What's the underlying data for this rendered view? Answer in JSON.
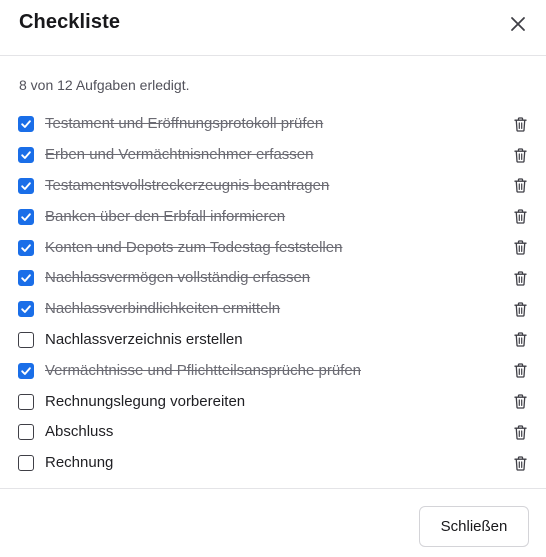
{
  "dialog": {
    "title": "Checkliste",
    "close_icon": "close-icon",
    "progress_text": "8 von 12 Aufgaben erledigt.",
    "close_button_label": "Schließen"
  },
  "colors": {
    "accent": "#1a6ee8",
    "done_text": "#6b6b73",
    "text": "#1f1f23"
  },
  "items": [
    {
      "label": "Testament und Eröffnungsprotokoll prüfen",
      "checked": true
    },
    {
      "label": "Erben und Vermächtnisnehmer erfassen",
      "checked": true
    },
    {
      "label": "Testamentsvollstreckerzeugnis beantragen",
      "checked": true
    },
    {
      "label": "Banken über den Erbfall informieren",
      "checked": true
    },
    {
      "label": "Konten und Depots zum Todestag feststellen",
      "checked": true
    },
    {
      "label": "Nachlassvermögen vollständig erfassen",
      "checked": true
    },
    {
      "label": "Nachlassverbindlichkeiten ermitteln",
      "checked": true
    },
    {
      "label": "Nachlassverzeichnis erstellen",
      "checked": false
    },
    {
      "label": "Vermächtnisse und Pflichtteilsansprüche prüfen",
      "checked": true
    },
    {
      "label": "Rechnungslegung vorbereiten",
      "checked": false
    },
    {
      "label": "Abschluss",
      "checked": false
    },
    {
      "label": "Rechnung",
      "checked": false
    }
  ]
}
